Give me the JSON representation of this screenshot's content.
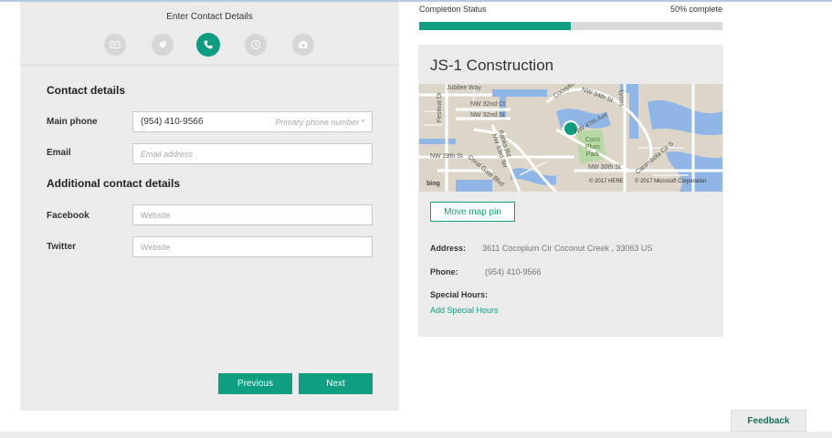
{
  "left": {
    "step_title": "Enter Contact Details",
    "steps": [
      {
        "icon": "id-card-icon"
      },
      {
        "icon": "tag-icon"
      },
      {
        "icon": "phone-icon"
      },
      {
        "icon": "clock-icon"
      },
      {
        "icon": "camera-icon"
      }
    ],
    "contact_details_title": "Contact details",
    "main_phone_label": "Main phone",
    "main_phone_value": "(954) 410-9566",
    "main_phone_placeholder": "Primary phone number *",
    "email_label": "Email",
    "email_placeholder": "Email address",
    "additional_title": "Additional contact details",
    "facebook_label": "Facebook",
    "facebook_placeholder": "Website",
    "twitter_label": "Twitter",
    "twitter_placeholder": "Website",
    "previous_label": "Previous",
    "next_label": "Next"
  },
  "right": {
    "completion_label": "Completion Status",
    "completion_text": "50% complete",
    "completion_fraction": 0.5,
    "business_name": "JS-1 Construction",
    "map_labels": {
      "jubilee": "Jubilee Way",
      "nw32ct": "NW 32nd Ct",
      "nw32st": "NW 32nd St",
      "nw34st": "NW 34th St",
      "nw47ave": "NW 47th Ave",
      "cocoplum": "Cocoplum",
      "lyons": "Lyons",
      "festival": "Festival Dr",
      "banks": "Banks Rd",
      "nw53": "NW 53rd Ter",
      "nw29st": "NW 29th St",
      "coralgate": "Coral Gate Blvd",
      "park": "Coco Plum Park",
      "nw30st": "NW 30th St",
      "caramola": "Carambola Cir S",
      "bing": "bing",
      "here": "© 2017 HERE",
      "microsoft": "© 2017 Microsoft Corporation"
    },
    "move_pin_label": "Move map pin",
    "address_label": "Address:",
    "address_value": "3611 Cocoplum Cir Coconut Creek , 33063 US",
    "phone_label": "Phone:",
    "phone_value": "(954) 410-9566",
    "special_hours_label": "Special Hours:",
    "add_special_hours": "Add Special Hours"
  },
  "feedback_label": "Feedback",
  "colors": {
    "accent": "#0f9f80",
    "panel": "#ebebeb",
    "progress_bg": "#d9d9d9"
  }
}
